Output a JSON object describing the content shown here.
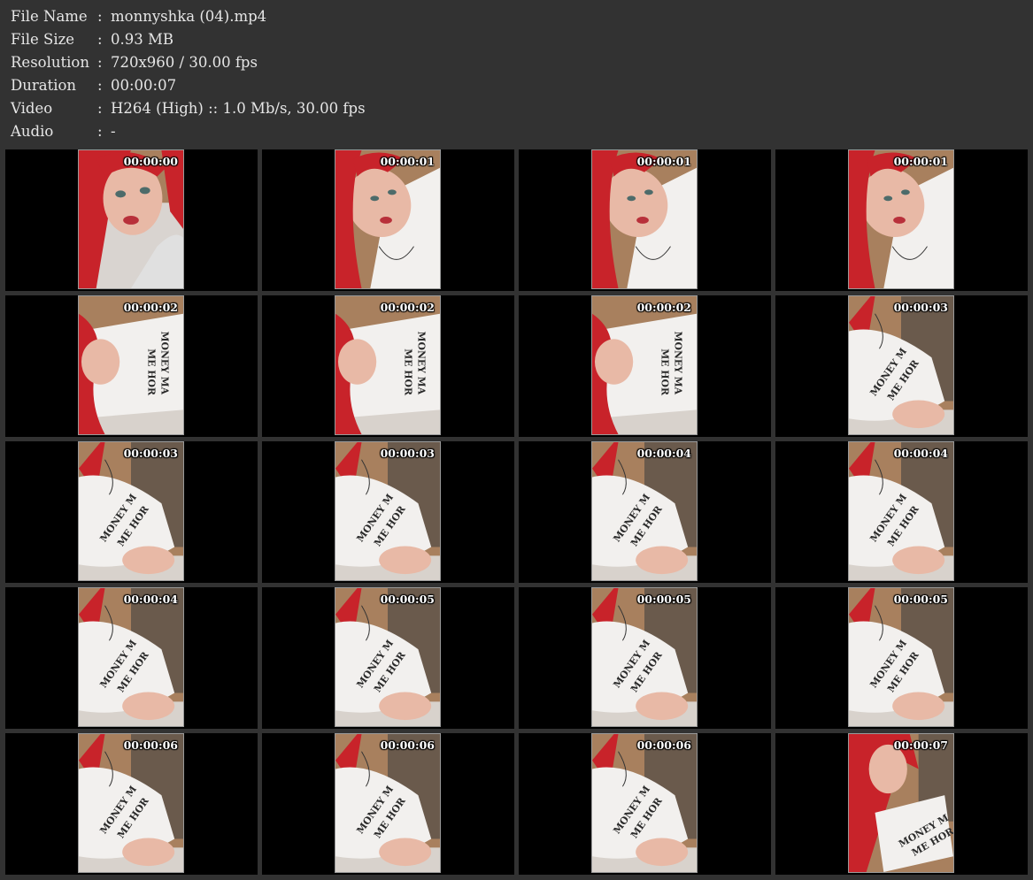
{
  "info": [
    {
      "label": "File Name",
      "colon": ":",
      "value": "monnyshka (04).mp4"
    },
    {
      "label": "File Size",
      "colon": ":",
      "value": "0.93 MB"
    },
    {
      "label": "Resolution",
      "colon": ":",
      "value": "720x960 / 30.00 fps"
    },
    {
      "label": "Duration",
      "colon": ":",
      "value": "00:00:07"
    },
    {
      "label": "Video",
      "colon": ":",
      "value": "H264 (High) :: 1.0 Mb/s, 30.00 fps"
    },
    {
      "label": "Audio",
      "colon": ":",
      "value": "-"
    }
  ],
  "thumbnails": [
    {
      "time": "00:00:00",
      "scene": "face"
    },
    {
      "time": "00:00:01",
      "scene": "face-tilt"
    },
    {
      "time": "00:00:01",
      "scene": "face-tilt"
    },
    {
      "time": "00:00:01",
      "scene": "face-tilt"
    },
    {
      "time": "00:00:02",
      "scene": "shirt-side"
    },
    {
      "time": "00:00:02",
      "scene": "shirt-side"
    },
    {
      "time": "00:00:02",
      "scene": "shirt-side"
    },
    {
      "time": "00:00:03",
      "scene": "shirt-body"
    },
    {
      "time": "00:00:03",
      "scene": "shirt-body"
    },
    {
      "time": "00:00:03",
      "scene": "shirt-body"
    },
    {
      "time": "00:00:04",
      "scene": "shirt-body"
    },
    {
      "time": "00:00:04",
      "scene": "shirt-body"
    },
    {
      "time": "00:00:04",
      "scene": "shirt-body"
    },
    {
      "time": "00:00:05",
      "scene": "shirt-body"
    },
    {
      "time": "00:00:05",
      "scene": "shirt-body"
    },
    {
      "time": "00:00:05",
      "scene": "shirt-body"
    },
    {
      "time": "00:00:06",
      "scene": "shirt-body"
    },
    {
      "time": "00:00:06",
      "scene": "shirt-body"
    },
    {
      "time": "00:00:06",
      "scene": "shirt-body"
    },
    {
      "time": "00:00:07",
      "scene": "face-shirt"
    }
  ],
  "colors": {
    "header_bg": "#323232",
    "cell_bg": "#000000",
    "hair": "#c8232a",
    "skin": "#e8b9a6",
    "shirt": "#f2f0ee",
    "wall": "#a8805e",
    "curtain": "#6a5a4c"
  }
}
